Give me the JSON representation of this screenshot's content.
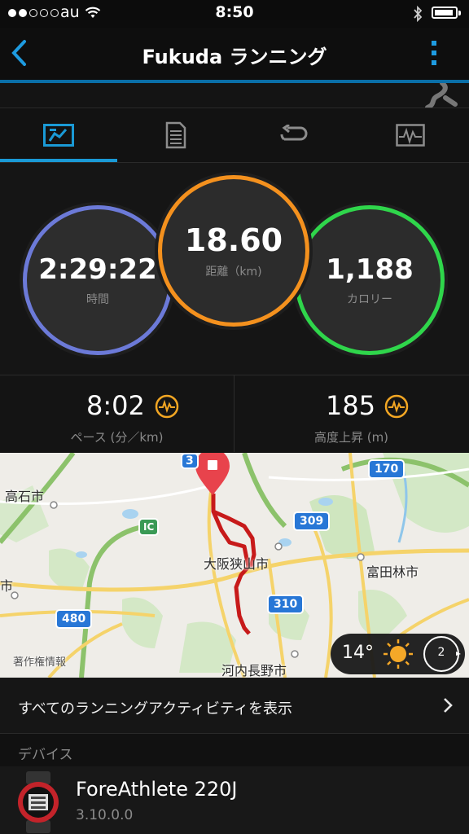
{
  "status_bar": {
    "carrier": "au",
    "time": "8:50"
  },
  "nav": {
    "title": "Fukuda ランニング"
  },
  "tabs": [
    {
      "name": "summary",
      "icon": "stats-chart-icon",
      "active": true
    },
    {
      "name": "details",
      "icon": "document-icon",
      "active": false
    },
    {
      "name": "laps",
      "icon": "repeat-icon",
      "active": false
    },
    {
      "name": "graph",
      "icon": "activity-graph-icon",
      "active": false
    }
  ],
  "stats": {
    "time": {
      "value": "2:29:22",
      "label": "時間",
      "color": "#6c7ad8"
    },
    "distance": {
      "value": "18.60",
      "label": "距離（km)",
      "color": "#f4911e"
    },
    "calories": {
      "value": "1,188",
      "label": "カロリー",
      "color": "#2fd64b"
    }
  },
  "metrics": {
    "pace": {
      "value": "8:02",
      "label": "ペース (分／km)"
    },
    "elevation": {
      "value": "185",
      "label": "高度上昇 (m)"
    }
  },
  "map": {
    "labels": [
      "高石市",
      "大阪狭山市",
      "富田林市",
      "河内長野市",
      "市",
      "著作権情報"
    ],
    "shields": [
      "170",
      "309",
      "310",
      "480",
      "3",
      "IC"
    ],
    "weather": {
      "temperature": "14°",
      "wind": "2"
    }
  },
  "all_activities": {
    "label": "すべてのランニングアクティビティを表示"
  },
  "devices": {
    "header": "デバイス",
    "name": "ForeAthlete 220J",
    "version": "3.10.0.0"
  }
}
